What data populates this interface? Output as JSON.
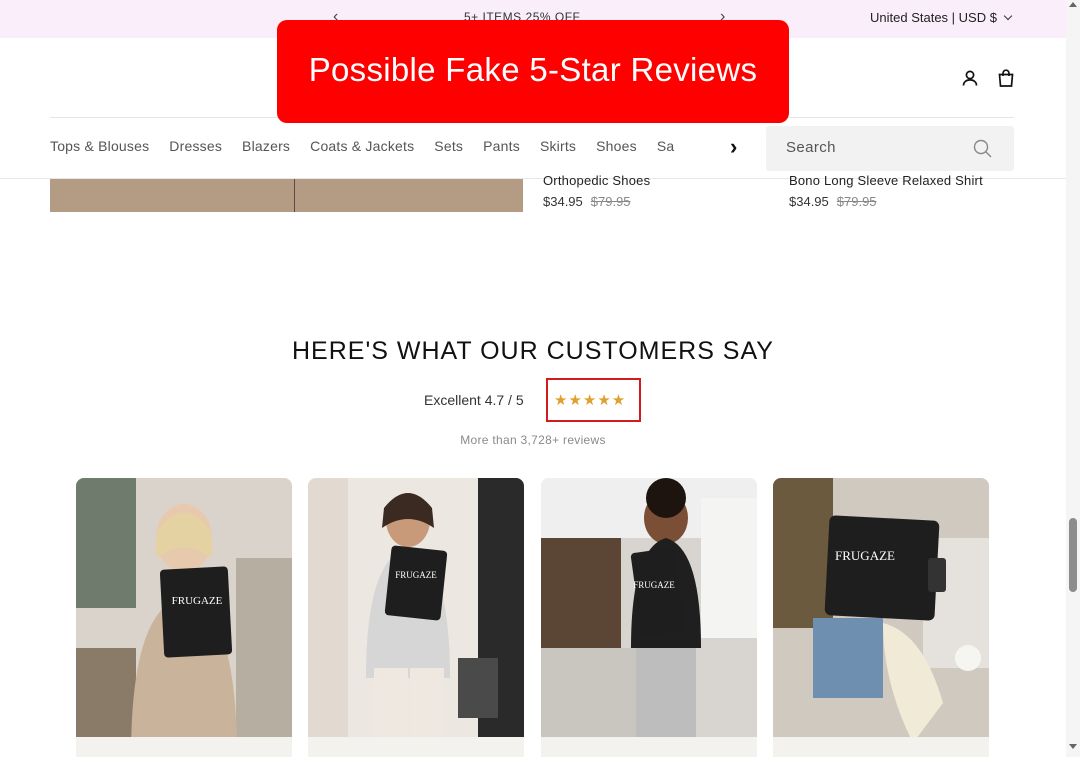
{
  "announcement": {
    "promo_text": "5+ ITEMS 25% OFF",
    "prev_icon": "chevron-left-icon",
    "next_icon": "chevron-right-icon",
    "locale": "United States | USD $"
  },
  "header": {
    "account_icon": "user-icon",
    "cart_icon": "shopping-bag-icon"
  },
  "nav": {
    "categories": [
      "Tops & Blouses",
      "Dresses",
      "Blazers",
      "Coats & Jackets",
      "Sets",
      "Pants",
      "Skirts",
      "Shoes",
      "Sa"
    ],
    "more_label": "›",
    "search_placeholder": "Search"
  },
  "products": [
    {
      "name": "Orthopedic Shoes",
      "price": "$34.95",
      "compare_price": "$79.95"
    },
    {
      "name": "Bono Long Sleeve Relaxed Shirt",
      "price": "$34.95",
      "compare_price": "$79.95"
    }
  ],
  "reviews": {
    "title": "HERE'S WHAT OUR CUSTOMERS SAY",
    "rating_text": "Excellent 4.7 / 5",
    "stars": "★★★★★",
    "count_text": "More than 3,728+ reviews",
    "star_color": "#e0a030",
    "highlight_color": "#d31b1b"
  },
  "photo_cards": [
    {
      "brand_on_bag": "FRUGAZE"
    },
    {
      "brand_on_bag": "FRUGAZE"
    },
    {
      "brand_on_bag": "FRUGAZE"
    },
    {
      "brand_on_bag": "FRUGAZE"
    }
  ],
  "overlay_banner": {
    "text": "Possible Fake 5-Star Reviews",
    "color": "#ff0000"
  }
}
